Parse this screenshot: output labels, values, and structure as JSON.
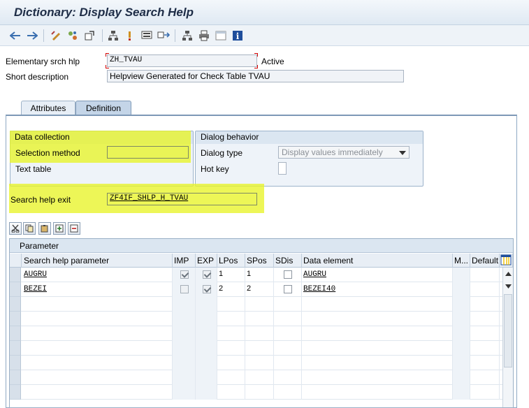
{
  "window": {
    "title": "Dictionary: Display Search Help"
  },
  "toolbar": {
    "icons": [
      "back-arrow-icon",
      "forward-arrow-icon",
      "edit-pencil-icon",
      "other-object-icon",
      "activate-icon",
      "where-used-icon",
      "hierarchy-icon",
      "check-icon",
      "display-object-list-icon",
      "navigate-icon",
      "tree-icon",
      "print-icon",
      "window-icon",
      "info-icon"
    ]
  },
  "header": {
    "elementary_label": "Elementary srch hlp",
    "elementary_value": "ZH_TVAU",
    "status": "Active",
    "short_desc_label": "Short description",
    "short_desc_value": "Helpview Generated for Check Table TVAU"
  },
  "tabs": [
    {
      "label": "Attributes",
      "active": false
    },
    {
      "label": "Definition",
      "active": true
    }
  ],
  "data_collection": {
    "title": "Data collection",
    "selection_method_label": "Selection method",
    "selection_method_value": "",
    "text_table_label": "Text table"
  },
  "dialog_behavior": {
    "title": "Dialog behavior",
    "dialog_type_label": "Dialog type",
    "dialog_type_value": "Display values immediately",
    "hot_key_label": "Hot key"
  },
  "exit": {
    "label": "Search help exit",
    "value": "ZF4IF_SHLP_H_TVAU"
  },
  "highlight_color": "#e8f428",
  "params_table": {
    "title": "Parameter",
    "columns": [
      "Search help parameter",
      "IMP",
      "EXP",
      "LPos",
      "SPos",
      "SDis",
      "Data element",
      "M...",
      "Default"
    ],
    "rows": [
      {
        "param": "AUGRU",
        "imp": true,
        "exp": true,
        "lpos": "1",
        "spos": "1",
        "sdis": false,
        "data_element": "AUGRU"
      },
      {
        "param": "BEZEI",
        "imp": false,
        "exp": true,
        "lpos": "2",
        "spos": "2",
        "sdis": false,
        "data_element": "BEZEI40"
      }
    ]
  }
}
